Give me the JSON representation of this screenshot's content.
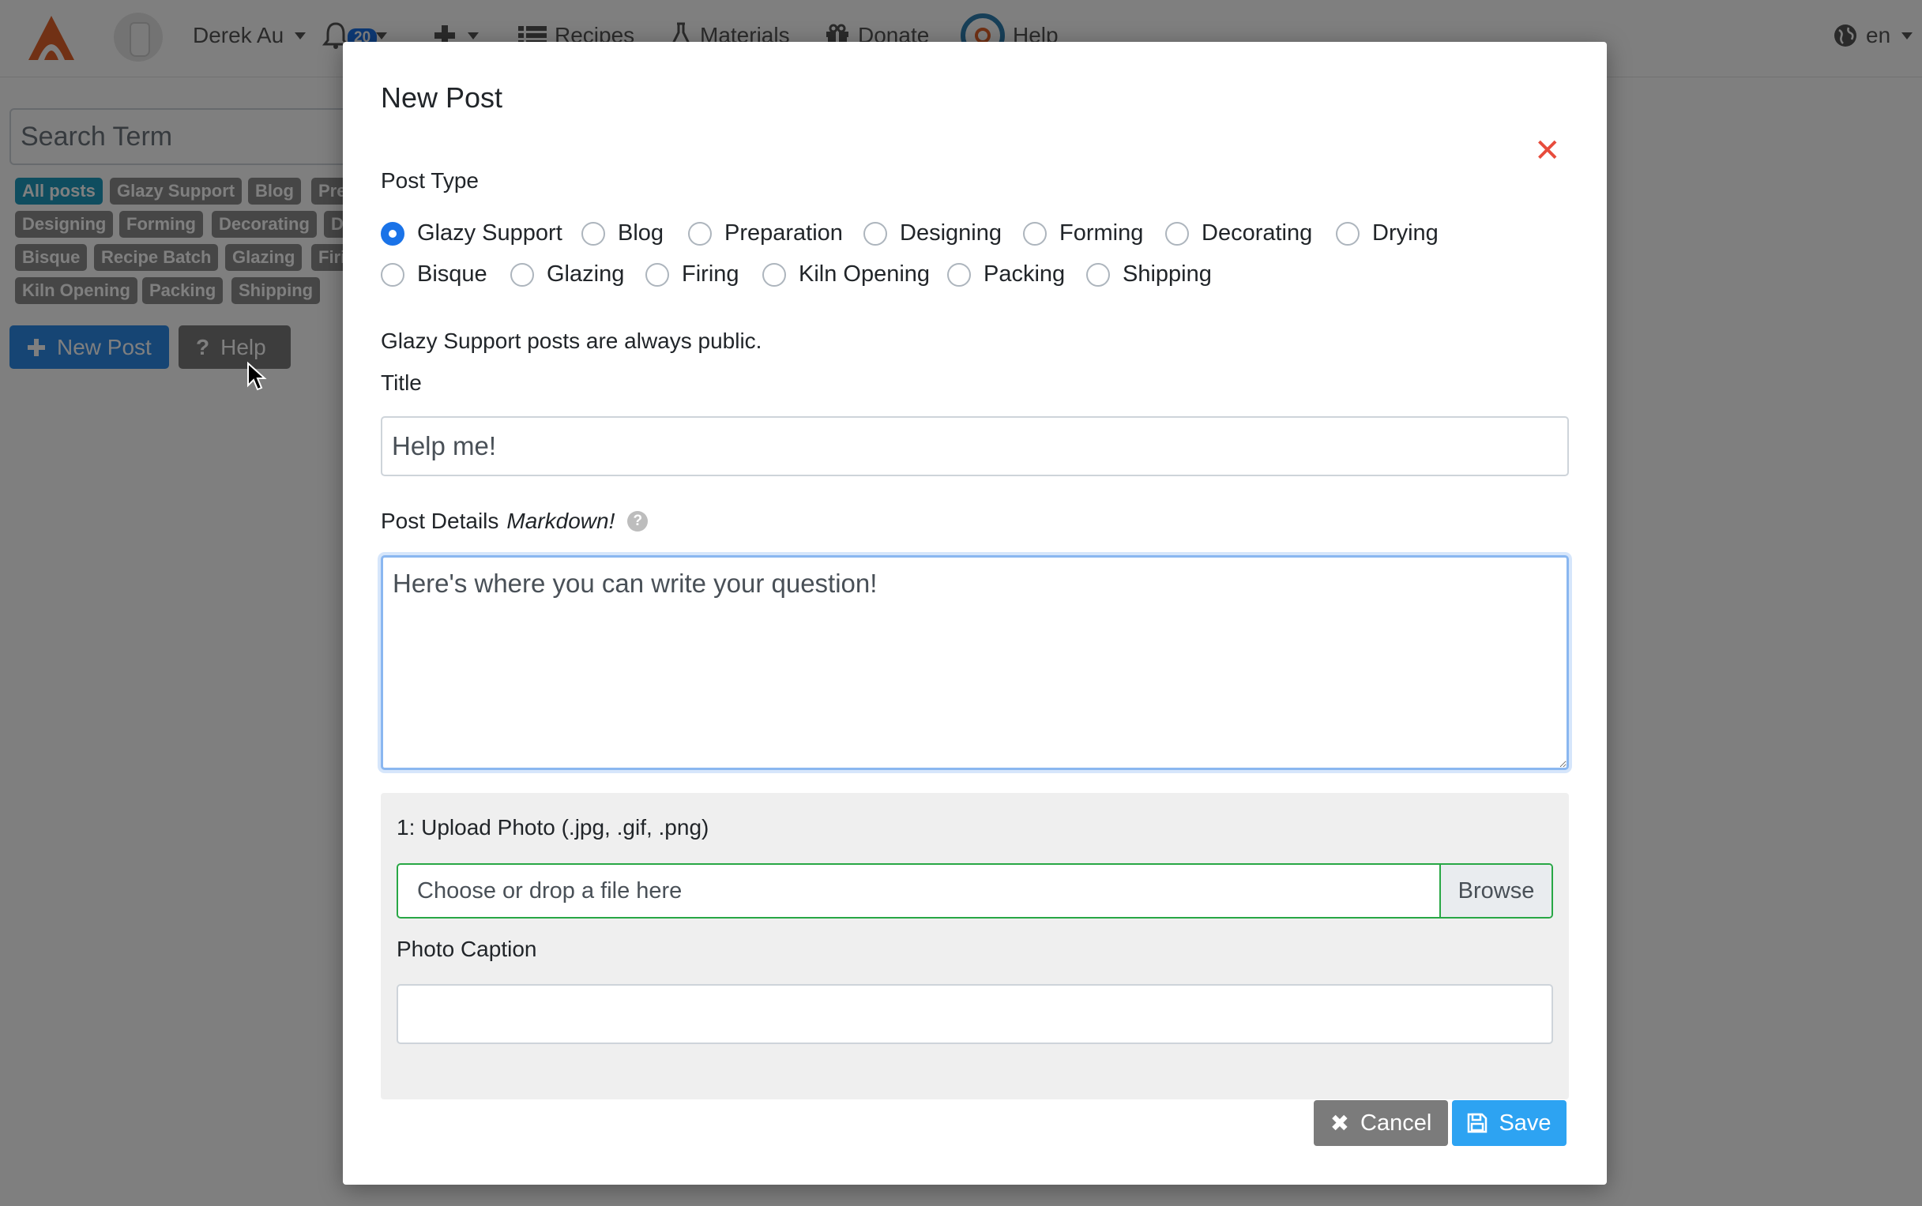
{
  "navbar": {
    "user_name": "Derek Au",
    "notification_count": "20",
    "recipes_label": "Recipes",
    "materials_label": "Materials",
    "donate_label": "Donate",
    "help_label": "Help",
    "language_label": "en"
  },
  "sidebar": {
    "search_placeholder": "Search Term",
    "tags": [
      "All posts",
      "Glazy Support",
      "Blog",
      "Preparation",
      "Designing",
      "Forming",
      "Decorating",
      "Drying",
      "Bisque",
      "Recipe Batch",
      "Glazing",
      "Firing",
      "Kiln Opening",
      "Packing",
      "Shipping"
    ],
    "active_tag": "All posts",
    "new_post_label": "New Post",
    "help_label": "Help"
  },
  "modal": {
    "title": "New Post",
    "post_type_label": "Post Type",
    "post_types_row1": [
      "Glazy Support",
      "Blog",
      "Preparation",
      "Designing",
      "Forming",
      "Decorating",
      "Drying"
    ],
    "post_types_row2": [
      "Bisque",
      "Glazing",
      "Firing",
      "Kiln Opening",
      "Packing",
      "Shipping"
    ],
    "selected_post_type": "Glazy Support",
    "public_note": "Glazy Support posts are always public.",
    "title_label": "Title",
    "title_value": "Help me!",
    "details_label": "Post Details",
    "details_label_emphasis": "Markdown!",
    "details_value": "Here's where you can write your question!",
    "upload_label": "1: Upload Photo (.jpg, .gif, .png)",
    "file_placeholder": "Choose or drop a file here",
    "browse_label": "Browse",
    "caption_label": "Photo Caption",
    "caption_value": "",
    "cancel_label": "Cancel",
    "save_label": "Save"
  },
  "colors": {
    "primary": "#1a73e8",
    "danger": "#e74c3c",
    "success_border": "#28a745",
    "brand_orange": "#e2622a"
  }
}
